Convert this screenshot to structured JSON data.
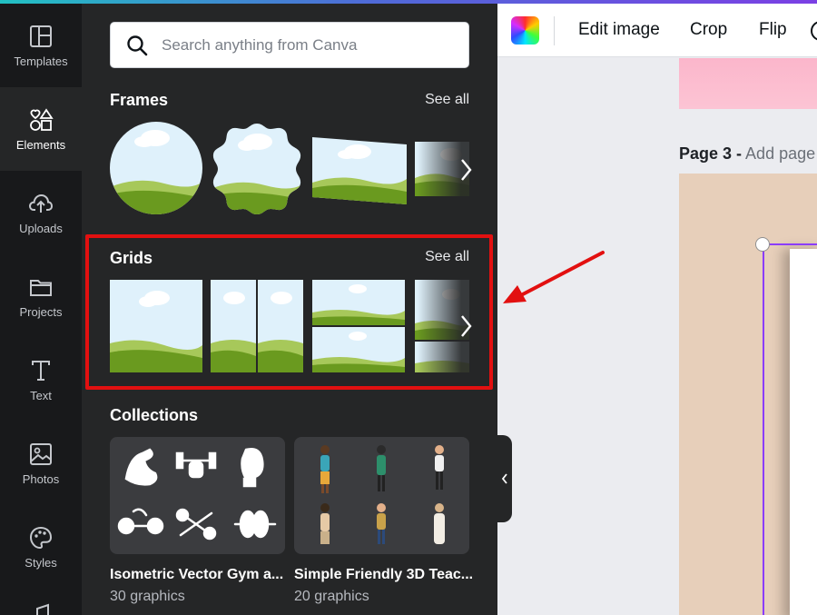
{
  "rail": {
    "items": [
      {
        "label": "Templates",
        "icon": "templates-icon"
      },
      {
        "label": "Elements",
        "icon": "elements-icon",
        "active": true
      },
      {
        "label": "Uploads",
        "icon": "upload-cloud-icon"
      },
      {
        "label": "Projects",
        "icon": "folder-icon"
      },
      {
        "label": "Text",
        "icon": "text-icon"
      },
      {
        "label": "Photos",
        "icon": "photo-icon"
      },
      {
        "label": "Styles",
        "icon": "palette-icon"
      }
    ]
  },
  "search": {
    "placeholder": "Search anything from Canva"
  },
  "frames": {
    "title": "Frames",
    "see_all": "See all"
  },
  "grids": {
    "title": "Grids",
    "see_all": "See all"
  },
  "collections": {
    "title": "Collections",
    "items": [
      {
        "title": "Isometric Vector Gym a...",
        "count": "30 graphics"
      },
      {
        "title": "Simple Friendly 3D Teac...",
        "count": "20 graphics"
      }
    ]
  },
  "toolbar": {
    "edit_image": "Edit image",
    "crop": "Crop",
    "flip": "Flip"
  },
  "canvas": {
    "page_label": "Page 3 -",
    "add_title": "Add page title"
  },
  "colors": {
    "highlight": "#e21010",
    "selection": "#8b3dff",
    "panel": "#252627",
    "rail": "#18191b"
  }
}
